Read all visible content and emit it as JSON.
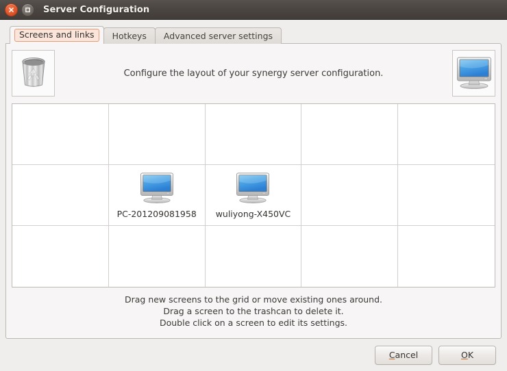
{
  "window": {
    "title": "Server Configuration",
    "close_icon": "close-icon",
    "maximize_icon": "maximize-icon",
    "titlebar_color": "#4b4641",
    "background_color": "#f0eeec"
  },
  "tabs": [
    {
      "label": "Screens and links",
      "active": true
    },
    {
      "label": "Hotkeys",
      "active": false
    },
    {
      "label": "Advanced server settings",
      "active": false
    }
  ],
  "header": {
    "trash_icon": "trashcan-icon",
    "description": "Configure the layout of your synergy server configuration.",
    "new_screen_icon": "monitor-icon"
  },
  "grid": {
    "columns": 5,
    "rows": 3,
    "cells": [
      {
        "row": 0,
        "col": 0,
        "screen": null
      },
      {
        "row": 0,
        "col": 1,
        "screen": null
      },
      {
        "row": 0,
        "col": 2,
        "screen": null
      },
      {
        "row": 0,
        "col": 3,
        "screen": null
      },
      {
        "row": 0,
        "col": 4,
        "screen": null
      },
      {
        "row": 1,
        "col": 0,
        "screen": null
      },
      {
        "row": 1,
        "col": 1,
        "screen": "PC-201209081958"
      },
      {
        "row": 1,
        "col": 2,
        "screen": "wuliyong-X450VC"
      },
      {
        "row": 1,
        "col": 3,
        "screen": null
      },
      {
        "row": 1,
        "col": 4,
        "screen": null
      },
      {
        "row": 2,
        "col": 0,
        "screen": null
      },
      {
        "row": 2,
        "col": 1,
        "screen": null
      },
      {
        "row": 2,
        "col": 2,
        "screen": null
      },
      {
        "row": 2,
        "col": 3,
        "screen": null
      },
      {
        "row": 2,
        "col": 4,
        "screen": null
      }
    ]
  },
  "instructions": [
    "Drag new screens to the grid or move existing ones around.",
    "Drag a screen to the trashcan to delete it.",
    "Double click on a screen to edit its settings."
  ],
  "buttons": {
    "cancel": {
      "pre": "C",
      "post": "ancel"
    },
    "ok": {
      "pre": "O",
      "post": "K"
    }
  },
  "colors": {
    "accent": "#e79b76",
    "accent_fill": "#fbe4da",
    "panel": "#f7f5f5",
    "grid_line": "#d2cfcc"
  }
}
